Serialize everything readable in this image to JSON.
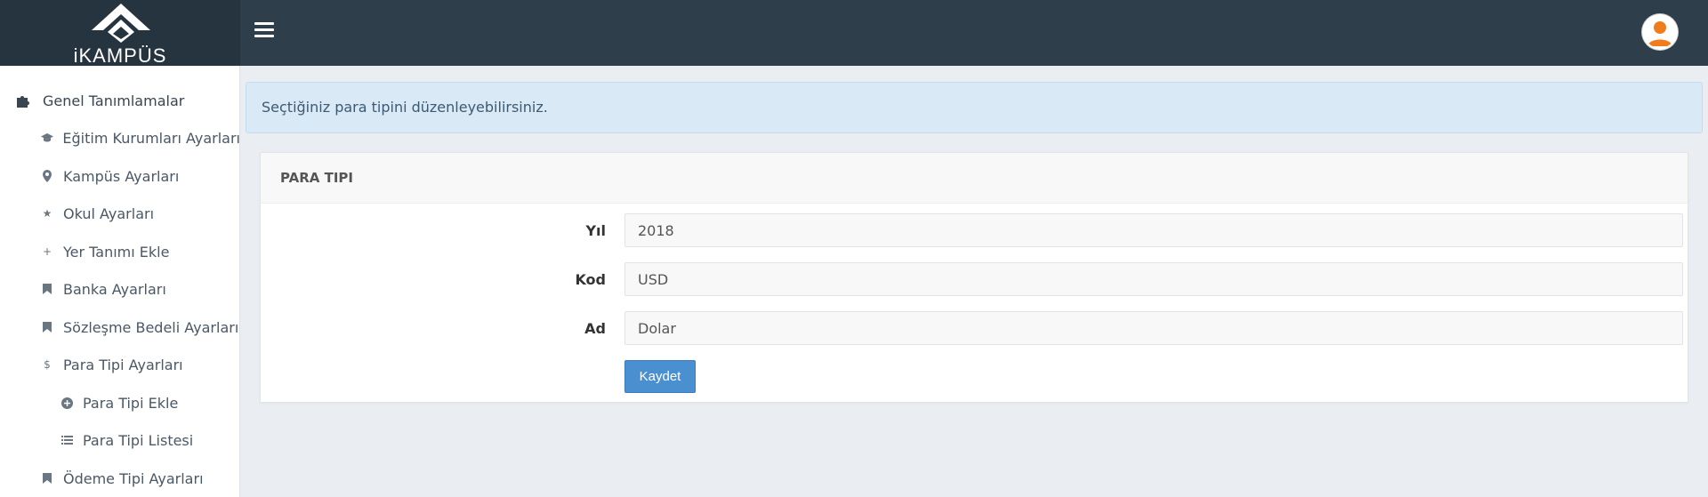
{
  "header": {
    "logo_text": "iKAMPÜS",
    "menu_icon": "hamburger-icon",
    "avatar_icon": "user-avatar-icon"
  },
  "sidebar": {
    "items": [
      {
        "label": "Genel Tanımlamalar",
        "icon": "puzzle-icon",
        "level": 0
      },
      {
        "label": "Eğitim Kurumları Ayarları",
        "icon": "graduation-cap-icon",
        "level": 1
      },
      {
        "label": "Kampüs Ayarları",
        "icon": "map-marker-icon",
        "level": 1
      },
      {
        "label": "Okul Ayarları",
        "icon": "star-icon",
        "level": 1
      },
      {
        "label": "Yer Tanımı Ekle",
        "icon": "plus-icon",
        "level": 1
      },
      {
        "label": "Banka Ayarları",
        "icon": "bookmark-icon",
        "level": 1
      },
      {
        "label": "Sözleşme Bedeli Ayarları",
        "icon": "bookmark-icon",
        "level": 1
      },
      {
        "label": "Para Tipi Ayarları",
        "icon": "dollar-icon",
        "level": 1
      },
      {
        "label": "Para Tipi Ekle",
        "icon": "plus-circle-icon",
        "level": 2
      },
      {
        "label": "Para Tipi Listesi",
        "icon": "list-icon",
        "level": 2
      },
      {
        "label": "Ödeme Tipi Ayarları",
        "icon": "bookmark-icon",
        "level": 1
      }
    ]
  },
  "alert": {
    "text": "Seçtiğiniz para tipini düzenleyebilirsiniz."
  },
  "panel": {
    "title": "PARA TIPI",
    "fields": [
      {
        "label": "Yıl",
        "value": "2018"
      },
      {
        "label": "Kod",
        "value": "USD"
      },
      {
        "label": "Ad",
        "value": "Dolar"
      }
    ],
    "save_label": "Kaydet"
  },
  "colors": {
    "header_bg": "#2e3e4b",
    "logo_bg": "#263440",
    "page_bg": "#eaedf1",
    "alert_bg": "#d9e9f6",
    "button_bg": "#4a90d0",
    "avatar_accent": "#f07c1b"
  }
}
